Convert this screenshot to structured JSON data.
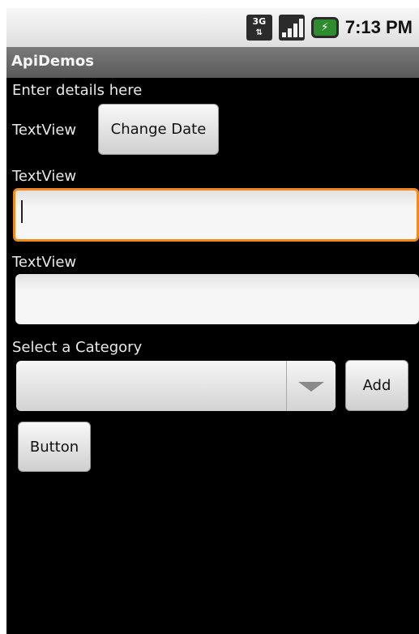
{
  "status_bar": {
    "network_label": "3G",
    "network_arrows": "⇅",
    "battery_symbol": "⚡",
    "time": "7:13 PM"
  },
  "app": {
    "title": "ApiDemos"
  },
  "form": {
    "intro_text": "Enter details here",
    "date_textview": "TextView",
    "change_date_label": "Change Date",
    "field1_label": "TextView",
    "field1_value": "",
    "field2_label": "TextView",
    "field2_value": "",
    "category_label": "Select a Category",
    "category_selected": "",
    "add_label": "Add",
    "button_label": "Button"
  },
  "colors": {
    "focus_border": "#f08a1d",
    "background": "#000000",
    "title_bar": "#666666"
  }
}
